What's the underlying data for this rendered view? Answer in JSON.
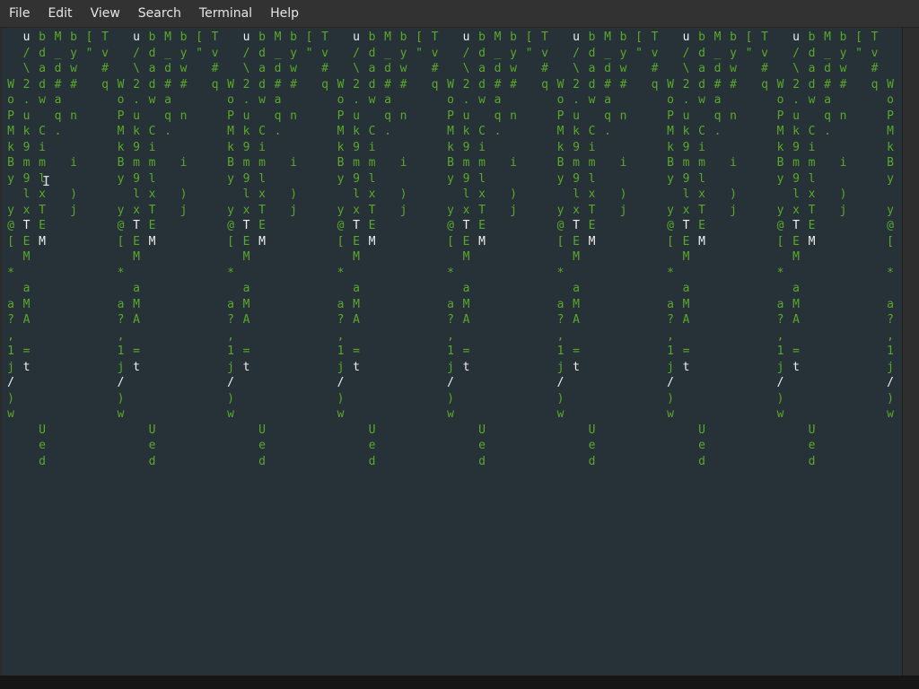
{
  "menu": [
    "File",
    "Edit",
    "View",
    "Search",
    "Terminal",
    "Help"
  ],
  "terminal": {
    "columns": [
      {
        "chars": "   WoPMkBy y@[ * a?,1j/)w",
        "white": [
          14,
          22
        ]
      },
      {
        "chars": "u/\\2.uk9m9lxTEM aMA =t    ",
        "white": [
          0,
          12,
          21
        ]
      },
      {
        "chars": "bdadw CimlxTEM           Ued",
        "white": [
          13
        ]
      },
      {
        "chars": "M_d#aq.",
        "white": []
      },
      {
        "chars": "byw# n  i )j",
        "white": []
      },
      {
        "chars": "[\"",
        "white": []
      },
      {
        "chars": "Tv#q",
        "white": [
          4
        ]
      }
    ],
    "cursor_symbol": "I"
  },
  "colors": {
    "background": "#263238",
    "glyph": "#5aa82a",
    "highlight": "#f2f2f2"
  }
}
